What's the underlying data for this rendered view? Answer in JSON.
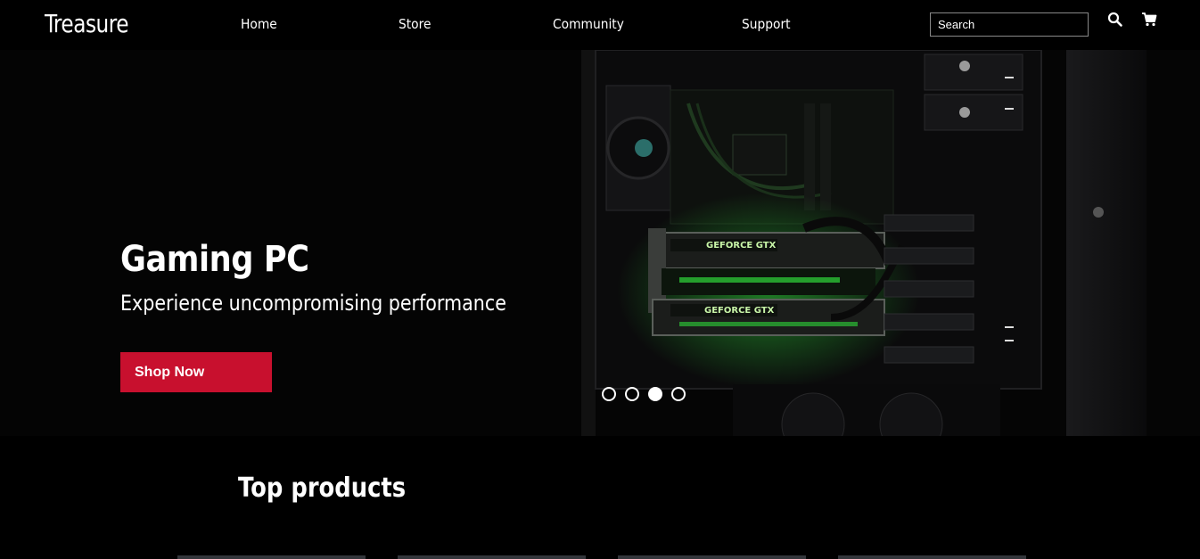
{
  "header": {
    "logo": "Treasure",
    "nav": [
      "Home",
      "Store",
      "Community",
      "Support"
    ],
    "search_placeholder": "Search"
  },
  "hero": {
    "title": "Gaming PC",
    "subtitle": "Experience uncompromising performance",
    "cta_label": "Shop Now",
    "slide_count": 4,
    "active_slide": 3,
    "gpu_label_1": "GEFORCE GTX",
    "gpu_label_2": "GEFORCE GTX"
  },
  "section": {
    "title": "Top products"
  },
  "colors": {
    "accent": "#c8102e",
    "background": "#000000",
    "gpu_glow": "#2fd93a"
  }
}
